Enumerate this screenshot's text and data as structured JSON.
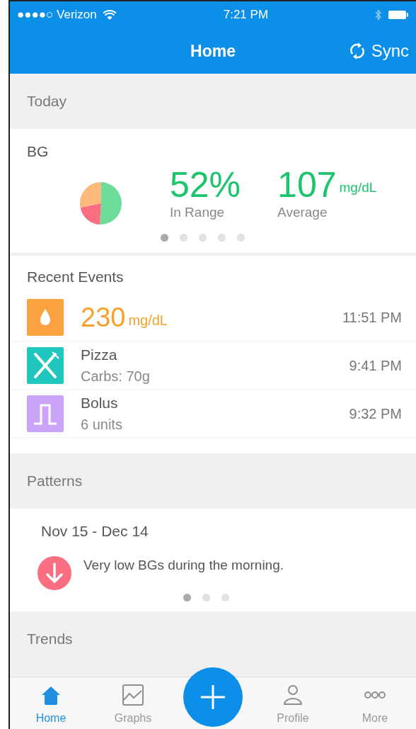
{
  "status_bar": {
    "carrier": "●●●●○ Verizon",
    "time": "7:21 PM"
  },
  "nav": {
    "title": "Home",
    "action": "Sync"
  },
  "sections": [
    {
      "kind": "header",
      "title": "Today"
    },
    {
      "kind": "bg",
      "title": "BG",
      "stats": [
        {
          "value": "52%",
          "label": "In Range"
        },
        {
          "value": "107",
          "unit": "mg/dL",
          "label": "Average"
        }
      ],
      "pages": [
        {
          "selected": true
        },
        {
          "selected": false
        },
        {
          "selected": false
        },
        {
          "selected": false
        },
        {
          "selected": false
        }
      ]
    },
    {
      "kind": "events",
      "title": "Recent Events",
      "events": [
        {
          "kind": "reading",
          "value": "230",
          "unit": "mg/dL",
          "time": "11:51 PM"
        },
        {
          "kind": "meal",
          "title": "Pizza",
          "detail": "Carbs: 70g",
          "time": "9:41 PM"
        },
        {
          "kind": "bolus",
          "title": "Bolus",
          "detail": "6 units",
          "time": "9:32 PM"
        }
      ]
    },
    {
      "kind": "header",
      "title": "Patterns"
    },
    {
      "kind": "patterns",
      "range": "Nov 15 - Dec 14",
      "message": "Very low BGs during the morning.",
      "pages": [
        {
          "selected": true
        },
        {
          "selected": false
        },
        {
          "selected": false
        }
      ]
    },
    {
      "kind": "header",
      "title": "Trends"
    }
  ],
  "tab_bar": [
    {
      "kind": "home",
      "label": "Home",
      "selected": true
    },
    {
      "kind": "graphs",
      "label": "Graphs",
      "selected": false
    },
    {
      "kind": "add"
    },
    {
      "kind": "profile",
      "label": "Profile",
      "selected": false
    },
    {
      "kind": "more",
      "label": "More",
      "selected": false
    }
  ]
}
